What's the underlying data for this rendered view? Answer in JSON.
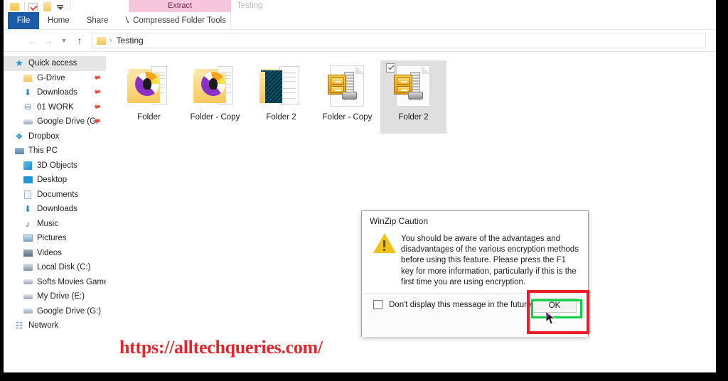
{
  "titlebar": {
    "quick_access_icons": [
      "folder-icon",
      "checklist-icon",
      "folder-icon",
      "customize-chevron-icon"
    ],
    "window_title": "Testing"
  },
  "ribbon": {
    "contextual_group_label": "Extract",
    "contextual_tab_label": "Compressed Folder Tools",
    "tabs": [
      {
        "label": "File",
        "kind": "file"
      },
      {
        "label": "Home",
        "kind": "normal"
      },
      {
        "label": "Share",
        "kind": "normal"
      },
      {
        "label": "View",
        "kind": "normal"
      }
    ],
    "file_tab_color": "#1c5ba5",
    "contextual_band_color": "#f6c6dc"
  },
  "addressbar": {
    "back_icon": "back-arrow-icon",
    "forward_icon": "forward-arrow-icon",
    "recent_icon": "chevron-down-icon",
    "up_icon": "up-arrow-icon",
    "folder_icon": "folder-icon",
    "separator": "›",
    "crumb": "Testing"
  },
  "sidebar": {
    "items": [
      {
        "label": "Quick access",
        "icon": "star-icon",
        "glyph": "★",
        "glyph_class": "g-star",
        "indent": 0,
        "selected": true,
        "pinned": false
      },
      {
        "label": "G-Drive",
        "icon": "folder-icon",
        "glyph": "",
        "glyph_class": "g-folder",
        "indent": 1,
        "selected": false,
        "pinned": true
      },
      {
        "label": "Downloads",
        "icon": "download-icon",
        "glyph": "⬇",
        "glyph_class": "g-dl",
        "indent": 1,
        "selected": false,
        "pinned": true
      },
      {
        "label": "01 WORK",
        "icon": "network-folder-icon",
        "glyph": "⛁",
        "glyph_class": "g-work",
        "indent": 1,
        "selected": false,
        "pinned": true
      },
      {
        "label": "Google Drive (G:",
        "icon": "drive-icon",
        "glyph": "",
        "glyph_class": "g-drive",
        "indent": 1,
        "selected": false,
        "pinned": true
      },
      {
        "label": "Dropbox",
        "icon": "dropbox-icon",
        "glyph": "❖",
        "glyph_class": "g-dropbox",
        "indent": 0,
        "selected": false,
        "pinned": false
      },
      {
        "label": "This PC",
        "icon": "this-pc-icon",
        "glyph": "",
        "glyph_class": "g-pc",
        "indent": 0,
        "selected": false,
        "pinned": false
      },
      {
        "label": "3D Objects",
        "icon": "3d-objects-icon",
        "glyph": "",
        "glyph_class": "g-3d",
        "indent": 1,
        "selected": false,
        "pinned": false
      },
      {
        "label": "Desktop",
        "icon": "desktop-icon",
        "glyph": "",
        "glyph_class": "g-desk",
        "indent": 1,
        "selected": false,
        "pinned": false
      },
      {
        "label": "Documents",
        "icon": "documents-icon",
        "glyph": "",
        "glyph_class": "g-doc",
        "indent": 1,
        "selected": false,
        "pinned": false
      },
      {
        "label": "Downloads",
        "icon": "download-icon",
        "glyph": "⬇",
        "glyph_class": "g-dl",
        "indent": 1,
        "selected": false,
        "pinned": false
      },
      {
        "label": "Music",
        "icon": "music-icon",
        "glyph": "♪",
        "glyph_class": "g-music",
        "indent": 1,
        "selected": false,
        "pinned": false
      },
      {
        "label": "Pictures",
        "icon": "pictures-icon",
        "glyph": "",
        "glyph_class": "g-pics",
        "indent": 1,
        "selected": false,
        "pinned": false
      },
      {
        "label": "Videos",
        "icon": "videos-icon",
        "glyph": "",
        "glyph_class": "g-vid",
        "indent": 1,
        "selected": false,
        "pinned": false
      },
      {
        "label": "Local Disk (C:)",
        "icon": "hard-disk-icon",
        "glyph": "",
        "glyph_class": "g-hdd",
        "indent": 1,
        "selected": false,
        "pinned": false
      },
      {
        "label": "Softs Movies Games",
        "icon": "drive-icon",
        "glyph": "",
        "glyph_class": "g-drive",
        "indent": 1,
        "selected": false,
        "pinned": false
      },
      {
        "label": "My Drive (E:)",
        "icon": "drive-icon",
        "glyph": "",
        "glyph_class": "g-drive",
        "indent": 1,
        "selected": false,
        "pinned": false
      },
      {
        "label": "Google Drive (G:)",
        "icon": "drive-icon",
        "glyph": "",
        "glyph_class": "g-drive",
        "indent": 1,
        "selected": false,
        "pinned": false
      },
      {
        "label": "Network",
        "icon": "network-icon",
        "glyph": "☷",
        "glyph_class": "g-net",
        "indent": 0,
        "selected": false,
        "pinned": false
      }
    ]
  },
  "content": {
    "files": [
      {
        "label": "Folder",
        "icon": "folder-with-disc-icon",
        "type": "folder",
        "selected": false,
        "checked": false
      },
      {
        "label": "Folder - Copy",
        "icon": "folder-with-disc-icon",
        "type": "folder",
        "selected": false,
        "checked": false
      },
      {
        "label": "Folder 2",
        "icon": "folder-with-documents-icon",
        "type": "folder2",
        "selected": false,
        "checked": false
      },
      {
        "label": "Folder - Copy",
        "icon": "winzip-archive-icon",
        "type": "zip",
        "selected": false,
        "checked": false
      },
      {
        "label": "Folder 2",
        "icon": "winzip-archive-icon",
        "type": "zip",
        "selected": true,
        "checked": true
      }
    ]
  },
  "watermark": {
    "text": "https://alltechqueries.com/",
    "color": "#e8232a"
  },
  "dialog": {
    "title": "WinZip Caution",
    "warning_icon": "warning-triangle-icon",
    "message": "You should be aware of the advantages and disadvantages of the various encryption methods before using this feature.  Please press the F1 key for more information, particularly if this is the first time you are using encryption.",
    "checkbox_label": "Don't display this message in the future",
    "checkbox_checked": false,
    "ok_label": "OK"
  },
  "annotations": {
    "red_box_color": "#ee1d23",
    "green_box_color": "#0ed145",
    "cursor_icon": "mouse-pointer-icon"
  }
}
